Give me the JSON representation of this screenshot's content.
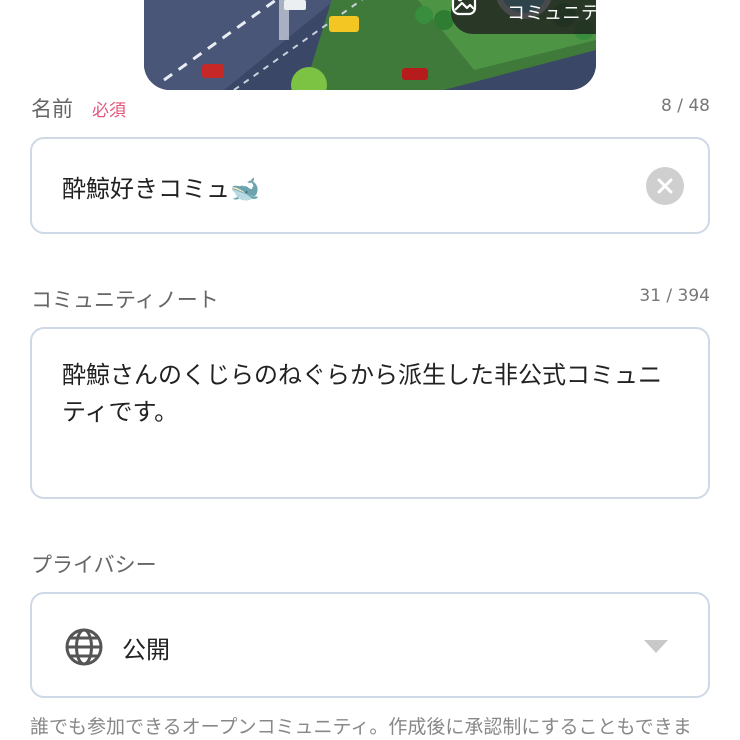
{
  "cover": {
    "change_label": "コミュニティ画像を変更",
    "icon": "image-edit-icon"
  },
  "name_field": {
    "label": "名前",
    "required_label": "必須",
    "counter": "8 / 48",
    "value": "酔鯨好きコミュ🐋",
    "clear_icon": "clear-icon"
  },
  "note_field": {
    "label": "コミュニティノート",
    "counter": "31 / 394",
    "value": "酔鯨さんのくじらのねぐらから派生した非公式コミュニティです。"
  },
  "privacy_field": {
    "label": "プライバシー",
    "value": "公開",
    "icon": "globe-icon",
    "dropdown_icon": "chevron-down-icon"
  },
  "hint": "誰でも参加できるオープンコミュニティ。作成後に承認制にすることもできま",
  "colors": {
    "required": "#e2567c",
    "border": "#cfd8e6",
    "label": "#666666"
  }
}
